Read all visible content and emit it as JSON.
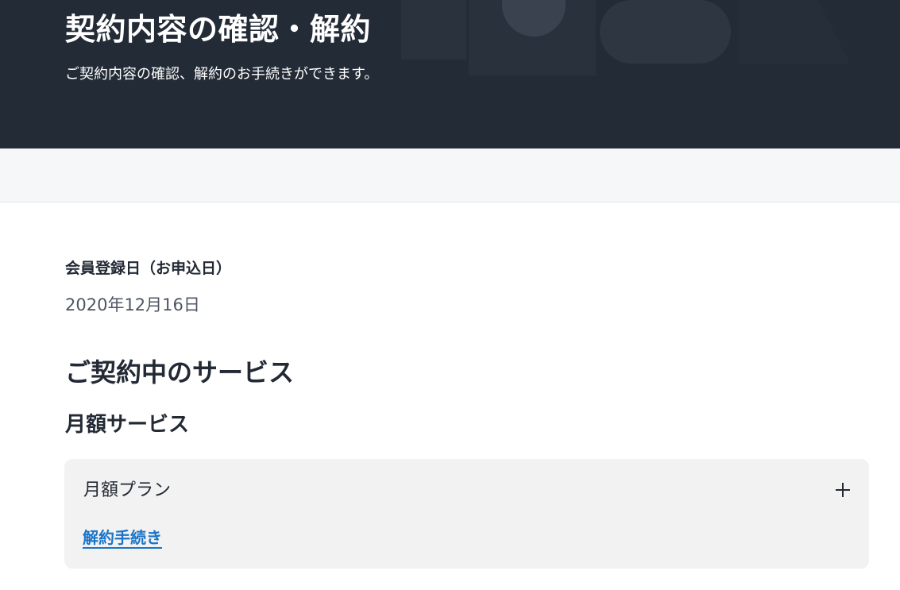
{
  "hero": {
    "title": "契約内容の確認・解約",
    "subtitle": "ご契約内容の確認、解約のお手続きができます。"
  },
  "registration": {
    "label": "会員登録日（お申込日）",
    "value": "2020年12月16日"
  },
  "services": {
    "heading": "ご契約中のサービス",
    "monthly": {
      "heading": "月額サービス",
      "plan": {
        "name": "月額プラン",
        "expand_icon": "plus-icon",
        "cancel_link": "解約手続き"
      }
    }
  },
  "colors": {
    "hero_background": "#232b36",
    "band_background": "#f6f7f9",
    "card_background": "#f2f2f2",
    "link": "#1a74c8",
    "text": "#232a35"
  }
}
